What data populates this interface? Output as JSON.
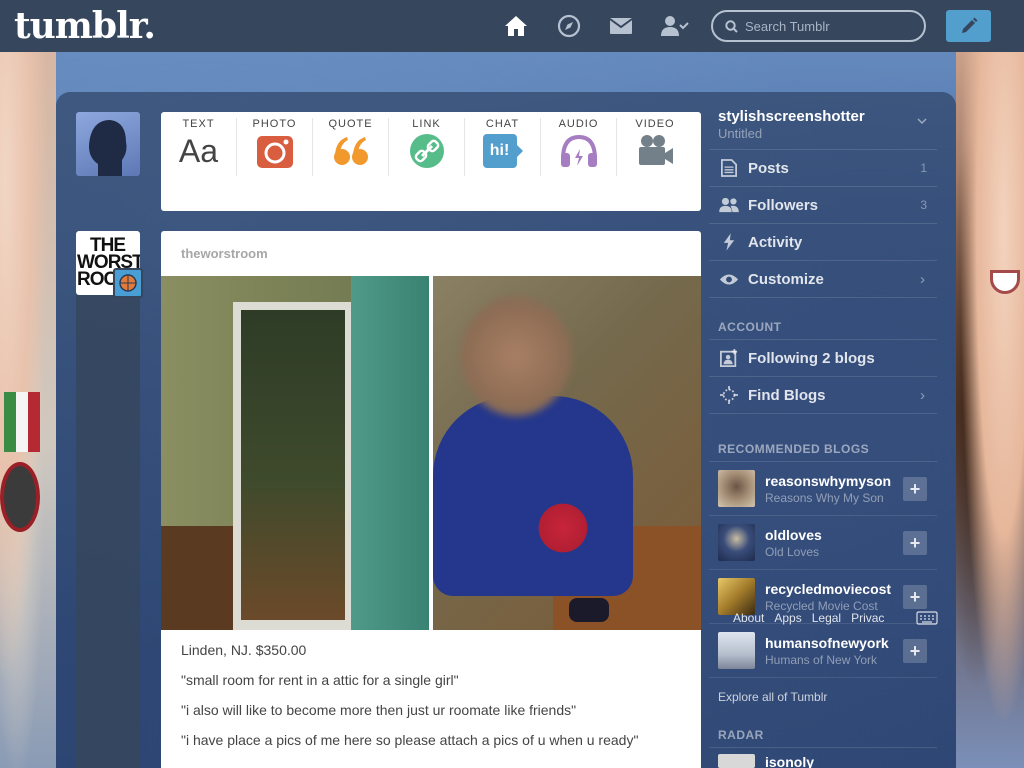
{
  "header": {
    "logo": "tumblr.",
    "search_placeholder": "Search Tumblr"
  },
  "post_types": [
    {
      "label": "TEXT",
      "glyph": "Aa",
      "icon": "text-icon",
      "color": "#444444"
    },
    {
      "label": "PHOTO",
      "icon": "camera-icon",
      "color": "#d95e40"
    },
    {
      "label": "QUOTE",
      "glyph": "66",
      "icon": "quote-icon",
      "color": "#f2992e"
    },
    {
      "label": "LINK",
      "icon": "link-icon",
      "color": "#56bc8a"
    },
    {
      "label": "CHAT",
      "glyph": "hi!",
      "icon": "chat-icon",
      "color": "#529ecc"
    },
    {
      "label": "AUDIO",
      "icon": "headphones-icon",
      "color": "#a77dc2"
    },
    {
      "label": "VIDEO",
      "icon": "video-camera-icon",
      "color": "#748089"
    }
  ],
  "blog_avatar": {
    "text": [
      "THE",
      "WORST",
      "ROC"
    ]
  },
  "post": {
    "author": "theworstroom",
    "lines": [
      "Linden, NJ. $350.00",
      "\"small room for rent in a attic for a single girl\"",
      "\"i also will like to become more then just ur roomate like friends\"",
      "\"i have place a pics of me here so please attach a pics of u when u ready\""
    ]
  },
  "sidebar": {
    "account": {
      "name": "stylishscreenshotter",
      "subtitle": "Untitled"
    },
    "items": [
      {
        "label": "Posts",
        "count": "1",
        "icon": "posts-icon"
      },
      {
        "label": "Followers",
        "count": "3",
        "icon": "followers-icon"
      },
      {
        "label": "Activity",
        "icon": "activity-icon"
      },
      {
        "label": "Customize",
        "icon": "eye-icon"
      }
    ],
    "account_label": "ACCOUNT",
    "account_items": [
      {
        "label": "Following 2 blogs",
        "icon": "following-icon"
      },
      {
        "label": "Find Blogs",
        "icon": "find-blogs-icon"
      }
    ],
    "recommended_label": "RECOMMENDED BLOGS",
    "recommended": [
      {
        "name": "reasonswhymyson",
        "sub": "Reasons Why My Son",
        "color": "#8a7766"
      },
      {
        "name": "oldloves",
        "sub": "Old Loves",
        "color": "#2b4f8a"
      },
      {
        "name": "recycledmoviecost",
        "sub": "Recycled Movie Cost",
        "color": "#b08a2e"
      },
      {
        "name": "humansofnewyork",
        "sub": "Humans of New York",
        "color": "#9aa7b8"
      }
    ],
    "explore": "Explore all of Tumblr",
    "radar_label": "RADAR",
    "radar_name": "isonoly"
  },
  "footer": {
    "links": [
      "About",
      "Apps",
      "Legal",
      "Privac"
    ]
  },
  "colors": {
    "nav": "#36465d",
    "accent": "#529ecc"
  }
}
